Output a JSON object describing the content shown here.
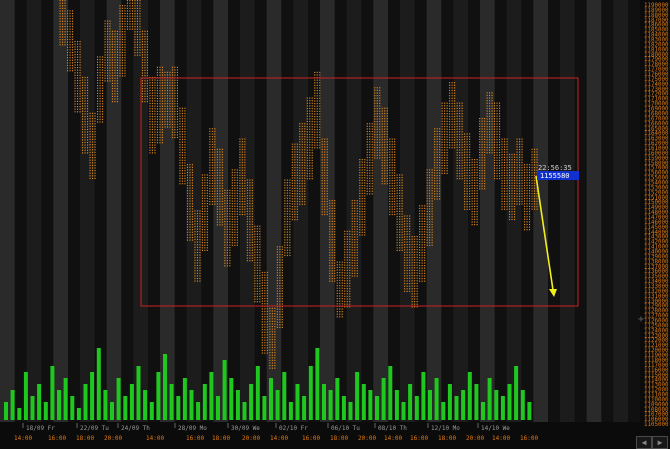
{
  "chart_data": {
    "type": "line",
    "style": "dot-plot (orange price marks)",
    "y_ticks": [
      1190000,
      1189000,
      1188000,
      1187000,
      1186000,
      1185000,
      1184000,
      1183000,
      1182000,
      1181000,
      1180000,
      1179000,
      1178000,
      1177000,
      1176000,
      1175000,
      1174000,
      1173000,
      1172000,
      1171000,
      1170000,
      1169000,
      1168000,
      1167000,
      1166000,
      1165000,
      1164000,
      1163000,
      1162000,
      1161000,
      1160000,
      1159000,
      1158000,
      1157000,
      1156000,
      1155000,
      1154000,
      1153000,
      1152000,
      1151000,
      1150000,
      1149000,
      1148000,
      1147000,
      1146000,
      1145000,
      1144000,
      1143000,
      1142000,
      1141000,
      1140000,
      1139000,
      1138000,
      1137000,
      1136000,
      1135000,
      1134000,
      1133000,
      1132000,
      1131000,
      1130000,
      1129000,
      1128000,
      1127000,
      1126000,
      1125000,
      1124000,
      1123000,
      1122000,
      1121000,
      1120000,
      1119000,
      1118000,
      1117000,
      1116000,
      1115000,
      1114000,
      1113000,
      1112000,
      1111000,
      1110000,
      1109000,
      1108000,
      1107000,
      1106000,
      1105000,
      1104000,
      1103000,
      1102000,
      1101000,
      1100000,
      1099000,
      1098000,
      1097000,
      1096000,
      1095000,
      1094000,
      1093000,
      1092000,
      1091000,
      1090000,
      1089000,
      1088000,
      1087000,
      1086000,
      1085000,
      1084000,
      1083000,
      1082000,
      1081000,
      1080000,
      1079000,
      1078000,
      1077000,
      1076000,
      1075000,
      1074000,
      1073000,
      1072000,
      1071000,
      1070000,
      1069000,
      1068000,
      1067000,
      1066000,
      1065000,
      1064000,
      1063000,
      1062000,
      1061000,
      1060000,
      1059000,
      1058000,
      1057000,
      1056000,
      1055000,
      1054000,
      1053000,
      1052000,
      1051000,
      1050000,
      1049000,
      1048000,
      1047000,
      1046000,
      1045000,
      1044000,
      1043000,
      1042000,
      1041000,
      1040000,
      1039000,
      1038000,
      1037000,
      1036000,
      1035000,
      1034000,
      1033000,
      1032000,
      1031000,
      1030000,
      1029000,
      1028000,
      1027000,
      1026000,
      1025000,
      1024000,
      1023000,
      1022000,
      1021000,
      1020000,
      1019000,
      1018000,
      1017000,
      1016000,
      1015000,
      1014000,
      1013000,
      1012000,
      1011000,
      1010000,
      1009000,
      1008000,
      1007000,
      1006000,
      1005000,
      1004000,
      1003000,
      1002000,
      1001000,
      1000000,
      999000,
      998000,
      997000,
      996000,
      995000,
      994000,
      993000,
      992000,
      991000,
      990000,
      989000,
      988000,
      987000,
      986000,
      985000,
      984000,
      983000,
      982000,
      981000,
      980000,
      979000,
      978000,
      977000,
      976000,
      975000,
      974000,
      973000,
      972000,
      971000,
      970000,
      969000,
      968000,
      967000,
      966000,
      965000,
      964000,
      963000,
      962000,
      961000,
      960000,
      959000,
      958000,
      957000,
      956000,
      955000,
      954000,
      953000,
      952000,
      951000,
      950000,
      949000,
      948000,
      947000,
      946000,
      945000,
      944000,
      943000,
      942000,
      941000,
      940000,
      939000,
      938000,
      937000,
      936000,
      935000,
      934000,
      933000,
      932000,
      931000,
      930000,
      929000,
      928000,
      927000,
      926000,
      925000,
      924000,
      923000,
      922000,
      921000,
      920000,
      919000,
      918000,
      917000,
      916000,
      915000,
      914000,
      913000,
      912000,
      911000,
      910000,
      909000,
      908000,
      907000,
      906000,
      905000,
      904000,
      903000,
      902000,
      901000,
      900000,
      899000,
      898000,
      897000,
      896000,
      895000,
      894000,
      893000,
      892000,
      891000,
      890000,
      889000,
      888000,
      887000,
      886000,
      885000,
      884000,
      883000,
      882000,
      881000,
      880000,
      879000,
      878000,
      877000,
      876000,
      875000,
      874000,
      873000,
      872000,
      871000,
      870000,
      869000,
      868000,
      867000,
      866000,
      865000,
      864000,
      863000,
      862000,
      861000,
      860000,
      859000,
      858000,
      857000,
      856000,
      855000,
      854000,
      853000,
      852000,
      851000,
      850000,
      849000,
      848000,
      847000,
      846000,
      845000,
      844000,
      843000,
      842000,
      841000,
      840000,
      839000,
      838000,
      837000,
      836000,
      835000,
      834000,
      833000,
      832000,
      831000,
      830000,
      829000,
      828000,
      827000,
      826000,
      825000,
      824000,
      823000,
      822000,
      821000,
      820000,
      819000,
      818000,
      817000,
      816000,
      815000,
      814000,
      813000,
      812000,
      811000,
      810000,
      809000,
      808000,
      807000,
      806000,
      805000,
      804000,
      803000,
      802000,
      801000,
      800000,
      799000,
      798000,
      797000,
      796000,
      795000,
      794000,
      793000,
      792000,
      791000,
      790000,
      789000,
      788000,
      787000,
      786000,
      785000,
      784000,
      783000,
      782000,
      781000,
      780000,
      779000,
      778000,
      777000,
      776000,
      775000,
      774000,
      773000,
      772000,
      771000,
      770000,
      769000,
      768000,
      767000,
      766000,
      765000,
      764000,
      763000,
      762000,
      761000,
      760000,
      759000,
      758000,
      757000,
      756000,
      755000,
      754000,
      753000,
      752000,
      751000,
      750000,
      749000,
      748000,
      747000,
      746000,
      745000,
      744000,
      743000,
      742000,
      741000,
      740000,
      739000,
      738000,
      737000,
      736000,
      735000,
      734000,
      733000,
      732000,
      731000,
      730000,
      729000,
      728000,
      727000,
      726000,
      725000,
      724000,
      723000,
      722000,
      721000,
      720000,
      719000,
      718000,
      717000,
      716000,
      715000,
      714000,
      713000,
      712000,
      711000,
      710000,
      709000,
      708000,
      707000,
      706000,
      705000,
      704000,
      703000,
      702000,
      701000,
      700000,
      699000,
      698000,
      697000,
      696000,
      695000,
      694000,
      693000,
      692000,
      691000,
      690000,
      689000,
      688000,
      687000,
      686000,
      685000,
      684000,
      683000,
      682000,
      681000,
      680000,
      679000,
      678000,
      677000,
      676000,
      675000,
      674000,
      673000,
      672000,
      671000,
      670000,
      669000,
      668000,
      667000,
      666000,
      665000,
      664000,
      663000,
      662000,
      661000,
      660000,
      659000,
      658000,
      657000,
      656000,
      655000,
      654000,
      653000,
      652000,
      651000,
      650000,
      649000,
      648000,
      647000,
      646000,
      645000,
      644000,
      643000,
      642000,
      641000,
      640000,
      639000,
      638000,
      637000,
      636000,
      635000,
      634000,
      633000,
      632000,
      631000,
      630000,
      629000,
      628000,
      627000,
      626000,
      625000,
      624000,
      623000,
      622000,
      621000,
      620000,
      619000,
      618000,
      617000,
      616000,
      615000,
      614000,
      613000,
      612000,
      611000,
      610000,
      609000,
      608000,
      607000,
      606000,
      605000,
      604000,
      603000,
      602000,
      601000,
      600000,
      599000,
      598000,
      597000,
      596000,
      595000,
      594000,
      593000,
      592000,
      591000,
      590000,
      589000,
      588000,
      587000,
      586000,
      585000,
      584000,
      583000,
      582000,
      581000,
      580000,
      579000,
      578000,
      577000,
      576000,
      575000,
      574000,
      573000,
      572000,
      571000,
      570000,
      569000,
      568000,
      567000,
      566000,
      565000,
      564000,
      563000,
      562000,
      561000,
      560000,
      559000,
      558000,
      557000,
      556000,
      555000,
      554000,
      553000,
      552000,
      551000,
      550000,
      549000,
      548000,
      547000,
      546000,
      545000,
      544000,
      543000,
      542000,
      541000,
      540000,
      539000,
      538000,
      537000,
      536000,
      535000,
      534000,
      533000,
      532000,
      531000,
      530000,
      529000,
      528000,
      527000,
      526000,
      525000,
      524000,
      523000,
      522000,
      521000,
      520000,
      519000,
      518000,
      517000,
      516000,
      515000,
      514000,
      513000,
      512000,
      511000,
      510000,
      509000,
      508000,
      507000,
      506000,
      505000,
      504000,
      503000,
      502000,
      501000,
      500000
    ],
    "y_tick_labels": [
      "1190000",
      "1189000",
      "1188000",
      "1187000",
      "1186000",
      "1185000",
      "1184000",
      "1183000",
      "1182000",
      "1181000",
      "1180000",
      "1179000",
      "1178000",
      "1177000",
      "1176000",
      "1175000",
      "1174000",
      "1173000",
      "1172000",
      "1171000",
      "1170000",
      "1169000",
      "1168000",
      "1167000",
      "1166000",
      "1165000",
      "1164000",
      "1163000",
      "1162000",
      "1161000",
      "1160000",
      "1159000",
      "1158000",
      "1157000",
      "1156000",
      "1155000",
      "1154000",
      "1153000",
      "1152000",
      "1151000",
      "1150000",
      "1149000",
      "1148000",
      "1147000",
      "1146000",
      "1145000",
      "1144000",
      "1143000",
      "1142000",
      "1141000",
      "1140000",
      "1139000",
      "1138000",
      "1137000",
      "1136000",
      "1135000",
      "1134000",
      "1133000",
      "1132000",
      "1131000",
      "1130000",
      "1129000",
      "1128000",
      "1127000",
      "1126000",
      "1125000",
      "1124000",
      "1123000",
      "1122000",
      "1121000",
      "1120000",
      "1119000",
      "1118000",
      "1117000",
      "1116000",
      "1115000",
      "1114000",
      "1113000",
      "1112000",
      "1111000",
      "1110000",
      "1109000",
      "1108000",
      "1107000",
      "1106000",
      "1105000"
    ],
    "x_date_labels": [
      "18/09 Fr",
      "22/09 Tu",
      "24/09 Th",
      "28/09 Mo",
      "30/09 We",
      "02/10 Fr",
      "06/10 Tu",
      "08/10 Th",
      "12/10 Mo",
      "14/10 We"
    ],
    "x_time_labels": [
      "14:00",
      "16:00",
      "18:00",
      "20:00",
      "14:00",
      "16:00",
      "18:00",
      "20:00",
      "14:00",
      "16:00",
      "18:00",
      "20:00",
      "14:00",
      "16:00",
      "18:00",
      "20:00",
      "14:00",
      "16:00",
      "18:00",
      "20:00"
    ],
    "price": [
      1186000,
      1183000,
      1176000,
      1168000,
      1161000,
      1173000,
      1180000,
      1177000,
      1183000,
      1190000,
      1186000,
      1178000,
      1168000,
      1170000,
      1173000,
      1171000,
      1163000,
      1152000,
      1142000,
      1150000,
      1159000,
      1154000,
      1146000,
      1151000,
      1156000,
      1147000,
      1138000,
      1128000,
      1121000,
      1134000,
      1148000,
      1155000,
      1159000,
      1163000,
      1169000,
      1156000,
      1143000,
      1131000,
      1137000,
      1144000,
      1152000,
      1160000,
      1167000,
      1162000,
      1156000,
      1149000,
      1140000,
      1136000,
      1143000,
      1150000,
      1159000,
      1164000,
      1169000,
      1163000,
      1157000,
      1152000,
      1161000,
      1168000,
      1163000,
      1156000,
      1152000,
      1157000,
      1150000,
      1155000
    ],
    "price_low": [
      1181000,
      1176000,
      1168000,
      1160000,
      1155000,
      1166000,
      1174000,
      1170000,
      1175000,
      1184000,
      1179000,
      1170000,
      1160000,
      1162000,
      1165000,
      1163000,
      1154000,
      1143000,
      1135000,
      1141000,
      1150000,
      1146000,
      1138000,
      1142000,
      1148000,
      1139000,
      1131000,
      1121000,
      1118000,
      1126000,
      1140000,
      1147000,
      1150000,
      1155000,
      1161000,
      1148000,
      1135000,
      1128000,
      1130000,
      1136000,
      1144000,
      1152000,
      1159000,
      1154000,
      1148000,
      1141000,
      1133000,
      1130000,
      1135000,
      1142000,
      1151000,
      1156000,
      1161000,
      1155000,
      1149000,
      1146000,
      1153000,
      1160000,
      1155000,
      1149000,
      1147000,
      1150000,
      1145000,
      1149000
    ],
    "price_high": [
      1190000,
      1188000,
      1182000,
      1175000,
      1168000,
      1179000,
      1186000,
      1184000,
      1189000,
      1190000,
      1190000,
      1184000,
      1175000,
      1177000,
      1176000,
      1177000,
      1169000,
      1158000,
      1149000,
      1156000,
      1165000,
      1161000,
      1153000,
      1157000,
      1163000,
      1155000,
      1146000,
      1137000,
      1130000,
      1142000,
      1155000,
      1162000,
      1166000,
      1171000,
      1176000,
      1163000,
      1151000,
      1139000,
      1145000,
      1151000,
      1159000,
      1166000,
      1173000,
      1169000,
      1163000,
      1156000,
      1148000,
      1144000,
      1150000,
      1157000,
      1165000,
      1170000,
      1174000,
      1170000,
      1164000,
      1159000,
      1167000,
      1172000,
      1170000,
      1163000,
      1160000,
      1163000,
      1158000,
      1161000
    ],
    "volume": [
      3,
      5,
      2,
      8,
      4,
      6,
      3,
      9,
      5,
      7,
      4,
      2,
      6,
      8,
      12,
      5,
      3,
      7,
      4,
      6,
      9,
      5,
      3,
      8,
      11,
      6,
      4,
      7,
      5,
      3,
      6,
      8,
      4,
      10,
      7,
      5,
      3,
      6,
      9,
      4,
      7,
      5,
      8,
      3,
      6,
      4,
      9,
      12,
      6,
      5,
      7,
      4,
      3,
      8,
      6,
      5,
      4,
      7,
      9,
      5,
      3,
      6,
      4,
      8,
      5,
      7,
      3,
      6,
      4,
      5,
      8,
      6,
      3,
      7,
      5,
      4,
      6,
      9,
      5,
      3
    ],
    "current_time": "22:56:35",
    "current_price": "1155580",
    "colors": {
      "background": "#0b0b0b",
      "session_band_light": "#2a2a2a",
      "session_band_dark": "#101010",
      "price_dots": "#e08a1e",
      "volume": "#1fc81f",
      "axis_text": "#e07a10",
      "box": "#cc2222",
      "arrow": "#f2ee1a",
      "price_badge": "#1030d0"
    }
  }
}
